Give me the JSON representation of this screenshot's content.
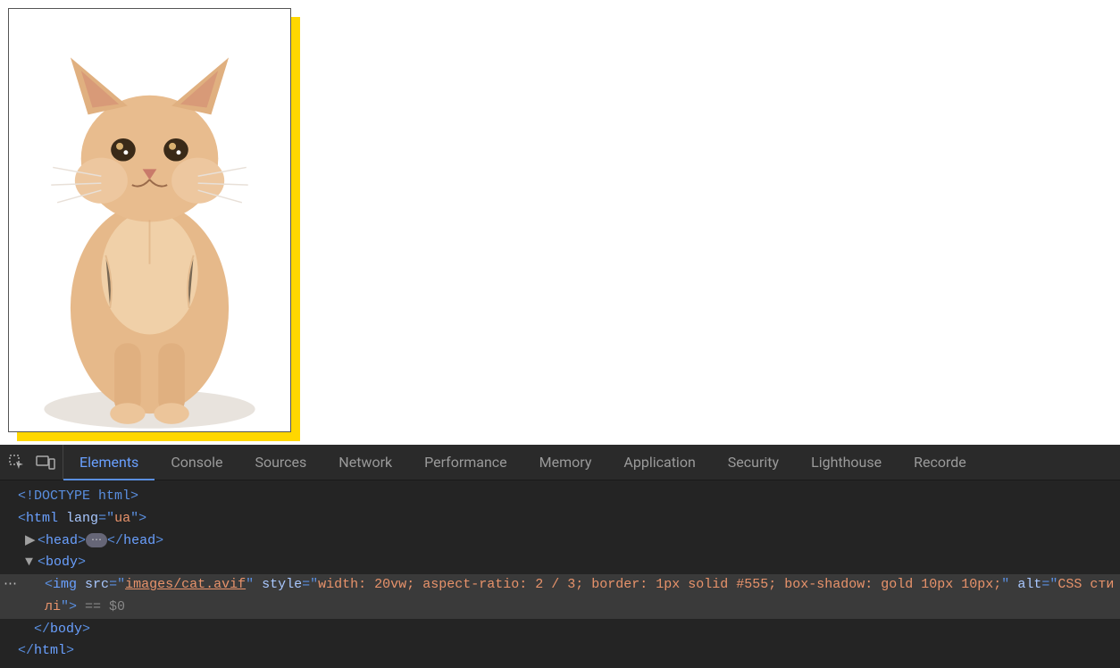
{
  "viewport": {
    "image_alt": "CSS стилі"
  },
  "devtools": {
    "tabs": {
      "elements": "Elements",
      "console": "Console",
      "sources": "Sources",
      "network": "Network",
      "performance": "Performance",
      "memory": "Memory",
      "application": "Application",
      "security": "Security",
      "lighthouse": "Lighthouse",
      "recorder": "Recorde"
    },
    "icons": {
      "inspect": "inspect",
      "device": "device-toolbar"
    },
    "dom": {
      "doctype": "<!DOCTYPE html>",
      "html_open_1": "<",
      "html_tag": "html",
      "html_attr_lang": "lang",
      "html_lang_val": "ua",
      "html_open_2": ">",
      "head_open": "<head>",
      "head_ellipsis": "⋯",
      "head_close": "</head>",
      "body_open": "<body>",
      "img_tag": "img",
      "img_src_attr": "src",
      "img_src_val": "images/cat.avif",
      "img_style_attr": "style",
      "img_style_val": "width: 20vw; aspect-ratio: 2 / 3; border: 1px solid #555; box-shadow: gold 10px 10px;",
      "img_alt_attr": "alt",
      "img_alt_val": "CSS стилі",
      "eq_dollar": " == $0",
      "body_close": "</body>",
      "html_close": "</html>",
      "gutter_ellipsis": "⋯"
    }
  }
}
